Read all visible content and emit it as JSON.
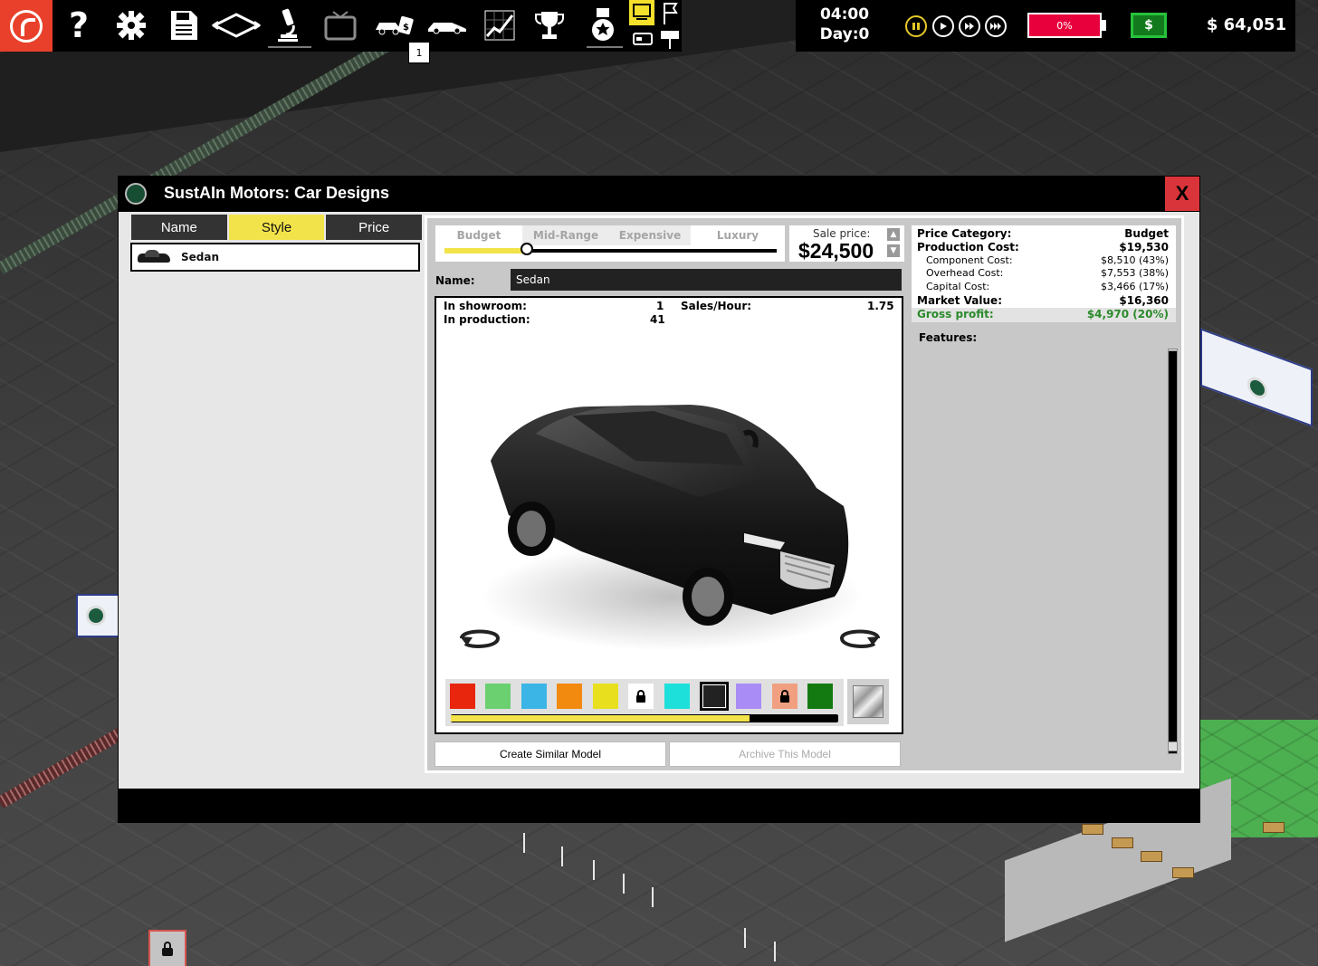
{
  "toolbar": {
    "badge_count": "1",
    "icons": [
      "company-logo",
      "help",
      "settings",
      "save",
      "map-view",
      "research",
      "advertising",
      "car-sales",
      "car-models",
      "charts",
      "achievements",
      "awards",
      "monitor",
      "flag"
    ]
  },
  "status": {
    "time": "04:00",
    "day": "Day:0",
    "battery": "0%",
    "cash_icon": "$",
    "money": "$ 64,051",
    "accent_yellow": "#e6c82a",
    "battery_color": "#e8003d",
    "cash_color": "#127a1d"
  },
  "dialog": {
    "title": "SustAIn Motors: Car Designs",
    "close": "X",
    "sort_tabs": [
      {
        "label": "Name",
        "active": false
      },
      {
        "label": "Style",
        "active": true
      },
      {
        "label": "Price",
        "active": false
      }
    ],
    "models": [
      {
        "name": "Sedan",
        "selected": true
      }
    ],
    "categories": [
      "Budget",
      "Mid-Range",
      "Expensive",
      "Luxury"
    ],
    "category_selected": "Budget",
    "sale_price_label": "Sale price:",
    "sale_price": "$24,500",
    "name_label": "Name:",
    "name_value": "Sedan",
    "stats": {
      "showroom_label": "In showroom:",
      "showroom_value": "1",
      "production_label": "In production:",
      "production_value": "41",
      "sales_label": "Sales/Hour:",
      "sales_value": "1.75"
    },
    "car_color": "#1b1b1b",
    "swatches": [
      {
        "color": "#e8250d",
        "locked": false,
        "selected": false
      },
      {
        "color": "#6bd06f",
        "locked": false,
        "selected": false
      },
      {
        "color": "#3bb5e6",
        "locked": false,
        "selected": false
      },
      {
        "color": "#f28a10",
        "locked": false,
        "selected": false
      },
      {
        "color": "#e8e01e",
        "locked": false,
        "selected": false
      },
      {
        "color": "#ffffff",
        "locked": true,
        "selected": false
      },
      {
        "color": "#1ee0da",
        "locked": false,
        "selected": false
      },
      {
        "color": "#222222",
        "locked": false,
        "selected": true
      },
      {
        "color": "#a98cf5",
        "locked": false,
        "selected": false
      },
      {
        "color": "#f0a080",
        "locked": true,
        "selected": false
      },
      {
        "color": "#137a12",
        "locked": false,
        "selected": false
      }
    ],
    "swatch_scroll_fraction": 0.77,
    "create_button": "Create Similar Model",
    "archive_button": "Archive This Model",
    "info": {
      "category_label": "Price Category:",
      "category_value": "Budget",
      "production_label": "Production Cost:",
      "production_value": "$19,530",
      "component_label": "Component Cost:",
      "component_value": "$8,510 (43%)",
      "overhead_label": "Overhead Cost:",
      "overhead_value": "$7,553 (38%)",
      "capital_label": "Capital Cost:",
      "capital_value": "$3,466 (17%)",
      "market_label": "Market Value:",
      "market_value": "$16,360",
      "profit_label": "Gross profit:",
      "profit_value": "$4,970 (20%)",
      "profit_color": "#2b8a2b"
    },
    "features_label": "Features:"
  }
}
